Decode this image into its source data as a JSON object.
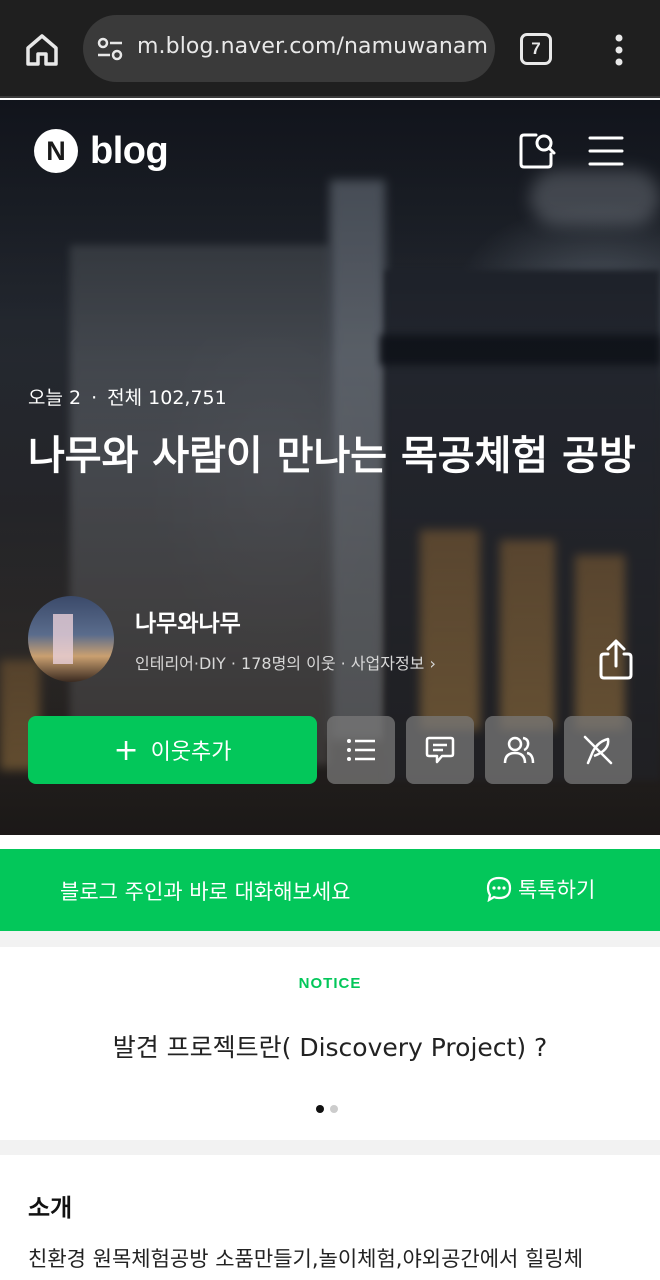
{
  "browser": {
    "url": "m.blog.naver.com/namuwanam",
    "tab_count": "7",
    "icons": [
      "home-icon",
      "site-settings-icon",
      "tab-switcher-icon",
      "more-vert-icon"
    ]
  },
  "header": {
    "logo_letter": "N",
    "logo_text": "blog",
    "icons": [
      "search-icon",
      "menu-icon"
    ]
  },
  "blog": {
    "today_label": "오늘 2",
    "separator": "·",
    "total_label": "전체 102,751",
    "title": "나무와 사람이 만나는 목공체험 공방",
    "nickname": "나무와나무",
    "meta": "인테리어·DIY · 178명의 이웃 · 사업자정보 ›"
  },
  "actions": {
    "add_neighbor": "이웃추가",
    "plus": "+",
    "icons": [
      "list-icon",
      "comment-icon",
      "neighbors-icon",
      "write-icon",
      "share-icon"
    ]
  },
  "talk": {
    "message": "블로그 주인과 바로 대화해보세요",
    "action": "톡톡하기"
  },
  "notice": {
    "label": "NOTICE",
    "text": "발견 프로젝트란( Discovery Project) ?",
    "page_index": 1,
    "page_count": 2
  },
  "intro": {
    "heading": "소개",
    "body": "친환경 원목체험공방 소품만들기,놀이체험,야외공간에서 힐링체"
  },
  "colors": {
    "brand_green": "#03c75a",
    "chrome_bg": "#1f1f1f",
    "dot_active": "#111111",
    "dot_inactive": "#cccccc"
  }
}
